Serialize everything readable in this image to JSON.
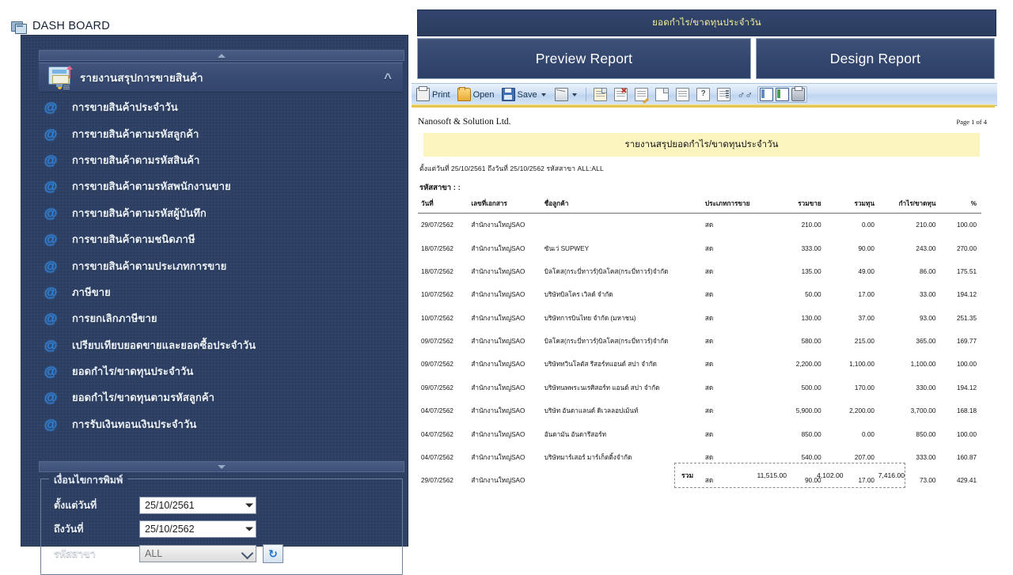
{
  "dashboard": {
    "window_title": "DASH BOARD",
    "group_header": "รายงานสรุปการขายสินค้า",
    "collapse_icon": "chevron-up-double-icon",
    "menu_items": [
      {
        "label": "การขายสินค้าประจำวัน"
      },
      {
        "label": "การขายสินค้าตามรหัสลูกค้า"
      },
      {
        "label": "การขายสินค้าตามรหัสสินค้า"
      },
      {
        "label": "การขายสินค้าตามรหัสพนักงานขาย"
      },
      {
        "label": "การขายสินค้าตามรหัสผู้บันทึก"
      },
      {
        "label": "การขายสินค้าตามชนิดภาษี"
      },
      {
        "label": "การขายสินค้าตามประเภทการขาย"
      },
      {
        "label": "ภาษีขาย"
      },
      {
        "label": "การยกเลิกภาษีขาย"
      },
      {
        "label": "เปรียบเทียบยอดขายและยอดซื้อประจำวัน"
      },
      {
        "label": "ยอดกำไร/ขาดทุนประจำวัน"
      },
      {
        "label": "ยอดกำไร/ขาดทุนตามรหัสลูกค้า"
      },
      {
        "label": "การรับเงินทอนเงินประจำวัน"
      }
    ],
    "conditions": {
      "legend": "เงื่อนไขการพิมพ์",
      "from_date_label": "ตั้งแต่วันที่",
      "from_date_value": "25/10/2561",
      "to_date_label": "ถึงวันที่",
      "to_date_value": "25/10/2562",
      "branch_label": "รหัสสาขา",
      "branch_value": "ALL",
      "refresh_icon": "refresh-icon"
    }
  },
  "report_panel": {
    "title_bar": "ยอดกำไร/ขาดทุนประจำวัน",
    "preview_button": "Preview Report",
    "design_button": "Design Report",
    "toolbar": {
      "print": "Print",
      "open": "Open",
      "save": "Save"
    }
  },
  "report": {
    "company": "Nanosoft & Solution Ltd.",
    "page_label": "Page 1 of 4",
    "title": "รายงานสรุปยอดกำไร/ขาดทุนประจำวัน",
    "criteria": "ตั้งแต่วันที่ 25/10/2561 ถึงวันที่ 25/10/2562  รหัสสาขา ALL:ALL",
    "branch_line": "รหัสสาขา : :",
    "columns": [
      "วันที่",
      "เลขที่เอกสาร",
      "ชื่อลูกค้า",
      "ประเภทการขาย",
      "รวมขาย",
      "รวมทุน",
      "กำไร/ขาดทุน",
      "%"
    ],
    "rows": [
      {
        "date": "29/07/2562",
        "doc": "สำนักงานใหญ่SAO",
        "customer": "",
        "type": "สด",
        "sale": "210.00",
        "cost": "0.00",
        "profit": "210.00",
        "pct": "100.00"
      },
      {
        "date": "18/07/2562",
        "doc": "สำนักงานใหญ่SAO",
        "customer": "ซันเว่ SUPWEY",
        "type": "สด",
        "sale": "333.00",
        "cost": "90.00",
        "profit": "243.00",
        "pct": "270.00"
      },
      {
        "date": "18/07/2562",
        "doc": "สำนักงานใหญ่SAO",
        "customer": "บิลโคส(กระบี่ทาวร์)บิลโคส(กระบี่ทาวร์)จำกัด",
        "type": "สด",
        "sale": "135.00",
        "cost": "49.00",
        "profit": "86.00",
        "pct": "175.51"
      },
      {
        "date": "10/07/2562",
        "doc": "สำนักงานใหญ่SAO",
        "customer": "บริษัทบิลโคร เวิลด์ จำกัด",
        "type": "สด",
        "sale": "50.00",
        "cost": "17.00",
        "profit": "33.00",
        "pct": "194.12"
      },
      {
        "date": "10/07/2562",
        "doc": "สำนักงานใหญ่SAO",
        "customer": "บริษัทการบินไทย จำกัด (มหาชน)",
        "type": "สด",
        "sale": "130.00",
        "cost": "37.00",
        "profit": "93.00",
        "pct": "251.35"
      },
      {
        "date": "09/07/2562",
        "doc": "สำนักงานใหญ่SAO",
        "customer": "บิลโคส(กระบี่ทาวร์)บิลโคส(กระบี่ทาวร์)จำกัด",
        "type": "สด",
        "sale": "580.00",
        "cost": "215.00",
        "profit": "365.00",
        "pct": "169.77"
      },
      {
        "date": "09/07/2562",
        "doc": "สำนักงานใหญ่SAO",
        "customer": "บริษัททวินโลตัส รีสอร์ทแอนด์ สปา จำกัด",
        "type": "สด",
        "sale": "2,200.00",
        "cost": "1,100.00",
        "profit": "1,100.00",
        "pct": "100.00"
      },
      {
        "date": "09/07/2562",
        "doc": "สำนักงานใหญ่SAO",
        "customer": "บริษัทนพพระนเรศิสอร์ท แอนด์ สปา จำกัด",
        "type": "สด",
        "sale": "500.00",
        "cost": "170.00",
        "profit": "330.00",
        "pct": "194.12"
      },
      {
        "date": "04/07/2562",
        "doc": "สำนักงานใหญ่SAO",
        "customer": "บริษัท อันดาแลนด์ ดิเวลลอปเม้นท์",
        "type": "สด",
        "sale": "5,900.00",
        "cost": "2,200.00",
        "profit": "3,700.00",
        "pct": "168.18"
      },
      {
        "date": "04/07/2562",
        "doc": "สำนักงานใหญ่SAO",
        "customer": "อันดามัน อันดารีสอร์ท",
        "type": "สด",
        "sale": "850.00",
        "cost": "0.00",
        "profit": "850.00",
        "pct": "100.00"
      },
      {
        "date": "04/07/2562",
        "doc": "สำนักงานใหญ่SAO",
        "customer": "บริษัทมาร์เสอร์ มาร์เก็ตติ้งจำกัด",
        "type": "สด",
        "sale": "540.00",
        "cost": "207.00",
        "profit": "333.00",
        "pct": "160.87"
      },
      {
        "date": "29/07/2562",
        "doc": "สำนักงานใหญ่SAO",
        "customer": "",
        "type": "สด",
        "sale": "90.00",
        "cost": "17.00",
        "profit": "73.00",
        "pct": "429.41"
      }
    ],
    "totals": {
      "label": "รวม",
      "sale": "11,515.00",
      "cost": "4,102.00",
      "profit": "7,416.00"
    }
  }
}
